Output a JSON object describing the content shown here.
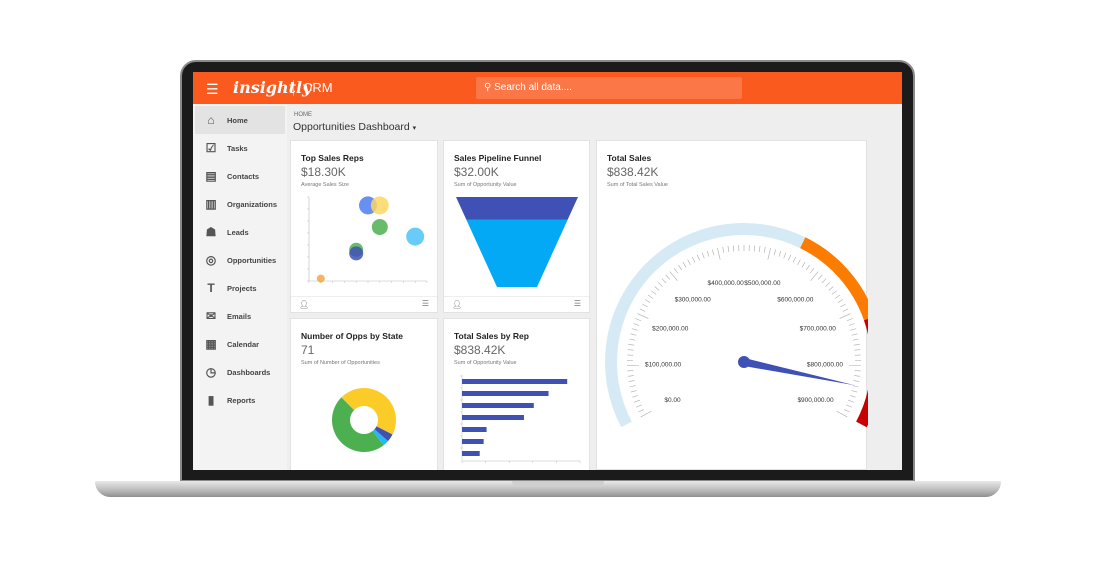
{
  "header": {
    "menu_icon": "hamburger-icon",
    "logo": "insightly",
    "product": "CRM",
    "search_placeholder": "Search all data....",
    "search_icon": "search-icon",
    "color": "#fb5a1f"
  },
  "sidebar": {
    "items": [
      {
        "label": "Home",
        "icon": "home-icon",
        "glyph": "⌂",
        "active": true
      },
      {
        "label": "Tasks",
        "icon": "checkbox-icon",
        "glyph": "☑"
      },
      {
        "label": "Contacts",
        "icon": "contact-card-icon",
        "glyph": "▤"
      },
      {
        "label": "Organizations",
        "icon": "building-icon",
        "glyph": "▥"
      },
      {
        "label": "Leads",
        "icon": "people-icon",
        "glyph": "☗"
      },
      {
        "label": "Opportunities",
        "icon": "target-icon",
        "glyph": "◎"
      },
      {
        "label": "Projects",
        "icon": "hammer-icon",
        "glyph": "T"
      },
      {
        "label": "Emails",
        "icon": "envelope-icon",
        "glyph": "✉"
      },
      {
        "label": "Calendar",
        "icon": "calendar-icon",
        "glyph": "▦"
      },
      {
        "label": "Dashboards",
        "icon": "gauge-icon",
        "glyph": "◷"
      },
      {
        "label": "Reports",
        "icon": "bar-chart-icon",
        "glyph": "▮"
      }
    ]
  },
  "breadcrumb": "HOME",
  "page_title": "Opportunities Dashboard",
  "cards": {
    "top_reps": {
      "title": "Top Sales Reps",
      "value": "$18.30K",
      "subtitle": "Average Sales Size"
    },
    "funnel": {
      "title": "Sales Pipeline Funnel",
      "value": "$32.00K",
      "subtitle": "Sum of Opportunity Value"
    },
    "total_sales": {
      "title": "Total Sales",
      "value": "$838.42K",
      "subtitle": "Sum of Total Sales Value"
    },
    "opps_state": {
      "title": "Number of Opps by State",
      "value": "71",
      "subtitle": "Sum of Number of Opportunities"
    },
    "sales_rep": {
      "title": "Total Sales by Rep",
      "value": "$838.42K",
      "subtitle": "Sum of Opportunity Value"
    }
  },
  "chart_data": [
    {
      "type": "scatter",
      "points": [
        {
          "x": 1,
          "y": 0.2,
          "r": 2,
          "color": "#f5a742"
        },
        {
          "x": 4,
          "y": 2.6,
          "r": 3.5,
          "color": "#4caf50"
        },
        {
          "x": 4,
          "y": 2.3,
          "r": 3.5,
          "color": "#3f51b5"
        },
        {
          "x": 5,
          "y": 6.3,
          "r": 4.5,
          "color": "#4d7cf0"
        },
        {
          "x": 6,
          "y": 6.3,
          "r": 4.5,
          "color": "#fdd663"
        },
        {
          "x": 6,
          "y": 4.5,
          "r": 4,
          "color": "#4caf50"
        },
        {
          "x": 9,
          "y": 3.7,
          "r": 4.5,
          "color": "#4fc3f7"
        }
      ],
      "xlim": [
        0,
        10
      ],
      "ylim": [
        0,
        7
      ]
    },
    {
      "type": "funnel",
      "segments": [
        {
          "share": 0.25,
          "color": "#3f51b5"
        },
        {
          "share": 0.75,
          "color": "#03a9f4"
        }
      ]
    },
    {
      "type": "gauge",
      "value": 838420,
      "range": [
        0,
        900000
      ],
      "ticks": [
        "$0.00",
        "$100,000.00",
        "$200,000.00",
        "$300,000.00",
        "$400,000.00",
        "$500,000.00",
        "$600,000.00",
        "$700,000.00",
        "$800,000.00",
        "$900,000.00"
      ],
      "bands": [
        {
          "from": 0,
          "to": 550000,
          "color": "#d6eaf5"
        },
        {
          "from": 550000,
          "to": 720000,
          "color": "#fb7c00"
        },
        {
          "from": 720000,
          "to": 900000,
          "color": "#c90000"
        }
      ],
      "needle_color": "#3f51b5"
    },
    {
      "type": "pie",
      "donut": true,
      "slices": [
        {
          "value": 45,
          "color": "#fbcc27"
        },
        {
          "value": 4,
          "color": "#3f51b5"
        },
        {
          "value": 3,
          "color": "#29b6f6"
        },
        {
          "value": 48,
          "color": "#4caf50"
        }
      ]
    },
    {
      "type": "bar",
      "orientation": "horizontal",
      "values": [
        107,
        88,
        73,
        63,
        25,
        22,
        18
      ],
      "color": "#3f51b5",
      "xlim": [
        0,
        120
      ]
    }
  ]
}
